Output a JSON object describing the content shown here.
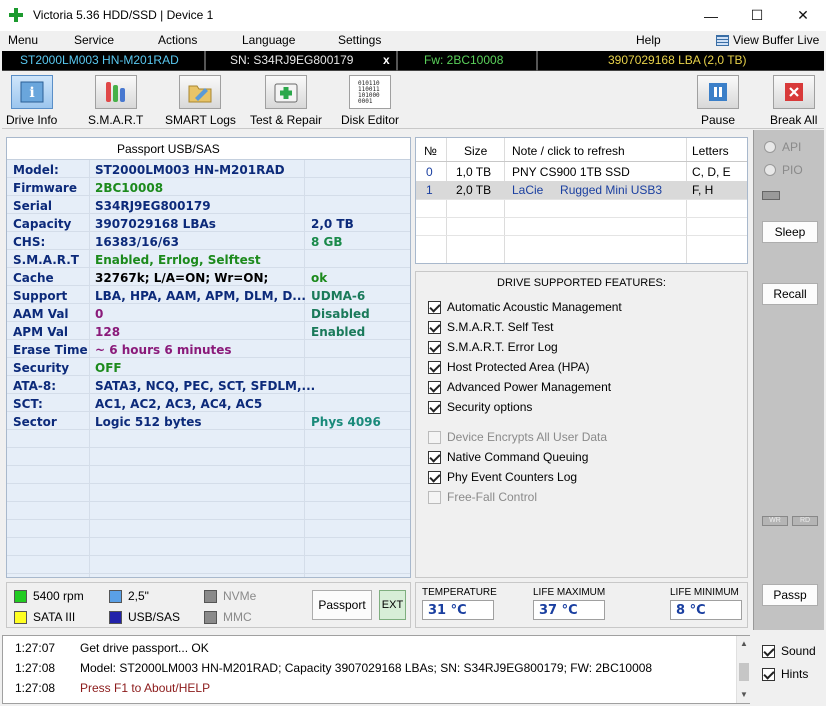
{
  "window": {
    "title": "Victoria 5.36 HDD/SSD | Device 1",
    "minimize": "—",
    "maximize": "☐",
    "close": "✕"
  },
  "menu": {
    "items": [
      "Menu",
      "Service",
      "Actions",
      "Language",
      "Settings",
      "Help"
    ],
    "view_buffer": "View Buffer Live"
  },
  "device_bar": {
    "model": "ST2000LM003 HN-M201RAD",
    "serial": "SN: S34RJ9EG800179",
    "close": "x",
    "firmware": "Fw: 2BC10008",
    "lba": "3907029168 LBA (2,0 TB)"
  },
  "toolbar": {
    "drive_info": "Drive Info",
    "smart": "S.M.A.R.T",
    "smart_logs": "SMART Logs",
    "test_repair": "Test & Repair",
    "disk_editor": "Disk Editor",
    "pause": "Pause",
    "break_all": "Break All",
    "disk_editor_bits": "010110\n110011\n101000\n0001"
  },
  "passport": {
    "title": "Passport USB/SAS",
    "rows": [
      {
        "k": "Model:",
        "v": "ST2000LM003 HN-M201RAD",
        "x": ""
      },
      {
        "k": "Firmware",
        "v": "2BC10008",
        "x": ""
      },
      {
        "k": "Serial",
        "v": "S34RJ9EG800179",
        "x": ""
      },
      {
        "k": "Capacity",
        "v": "3907029168 LBAs",
        "x": "2,0 TB"
      },
      {
        "k": "CHS:",
        "v": "16383/16/63",
        "x": "8 GB"
      },
      {
        "k": "S.M.A.R.T",
        "v": "Enabled, Errlog, Selftest",
        "x": ""
      },
      {
        "k": "Cache",
        "v": "32767k; L/A=ON; Wr=ON;",
        "x": "ok"
      },
      {
        "k": "Support",
        "v": "LBA, HPA, AAM, APM, DLM, D...",
        "x": "UDMA-6"
      },
      {
        "k": "AAM Val",
        "v": "0",
        "x": "Disabled"
      },
      {
        "k": "APM Val",
        "v": "128",
        "x": "Enabled"
      },
      {
        "k": "Erase Time",
        "v": "~ 6 hours 6 minutes",
        "x": ""
      },
      {
        "k": "Security",
        "v": "OFF",
        "x": ""
      },
      {
        "k": "ATA-8:",
        "v": "SATA3, NCQ, PEC, SCT, SFDLM,...",
        "x": ""
      },
      {
        "k": "SCT:",
        "v": "AC1, AC2, AC3, AC4, AC5",
        "x": ""
      },
      {
        "k": "Sector",
        "v": "Logic 512 bytes",
        "x": "Phys 4096"
      }
    ]
  },
  "disks": {
    "headers": [
      "№",
      "Size",
      "Note / click to refresh",
      "Letters"
    ],
    "rows": [
      {
        "n": "0",
        "size": "1,0 TB",
        "note": "PNY CS900 1TB SSD",
        "letters": "C, D, E"
      },
      {
        "n": "1",
        "size": "2,0 TB",
        "note": "LaCie     Rugged Mini USB3",
        "letters": "F, H"
      }
    ]
  },
  "features": {
    "title": "DRIVE SUPPORTED FEATURES:",
    "items": [
      {
        "label": "Automatic Acoustic Management",
        "checked": true,
        "enabled": true
      },
      {
        "label": "S.M.A.R.T. Self Test",
        "checked": true,
        "enabled": true
      },
      {
        "label": "S.M.A.R.T. Error Log",
        "checked": true,
        "enabled": true
      },
      {
        "label": "Host Protected Area (HPA)",
        "checked": true,
        "enabled": true
      },
      {
        "label": "Advanced Power Management",
        "checked": true,
        "enabled": true
      },
      {
        "label": "Security options",
        "checked": true,
        "enabled": true
      },
      {
        "label": "Device Encrypts All User Data",
        "checked": false,
        "enabled": false
      },
      {
        "label": "Native Command Queuing",
        "checked": true,
        "enabled": true
      },
      {
        "label": "Phy Event Counters Log",
        "checked": true,
        "enabled": true
      },
      {
        "label": "Free-Fall Control",
        "checked": false,
        "enabled": false
      }
    ]
  },
  "side": {
    "api": "API",
    "pio": "PIO",
    "sleep": "Sleep",
    "recall": "Recall",
    "passp": "Passp",
    "wr": "WR",
    "rd": "RD"
  },
  "legend": {
    "rpm": "5400 rpm",
    "size": "2,5\"",
    "nvme": "NVMe",
    "sata": "SATA III",
    "usbsas": "USB/SAS",
    "mmc": "MMC",
    "passport_btn": "Passport",
    "ext_btn": "EXT",
    "colors": {
      "rpm": "#22cc22",
      "size": "#5aa0e6",
      "nvme": "#8a8a8a",
      "sata": "#ffff22",
      "usbsas": "#2222aa",
      "mmc": "#8a8a8a"
    }
  },
  "stats": {
    "temperature_label": "TEMPERATURE",
    "temperature": "31 °C",
    "life_max_label": "LIFE MAXIMUM",
    "life_max": "37 °C",
    "life_min_label": "LIFE MINIMUM",
    "life_min": "8 °C"
  },
  "log": [
    {
      "time": "1:27:07",
      "msg": "Get drive passport... OK",
      "color": "#000000"
    },
    {
      "time": "1:27:08",
      "msg": "Model: ST2000LM003 HN-M201RAD; Capacity 3907029168 LBAs; SN: S34RJ9EG800179; FW: 2BC10008",
      "color": "#000000"
    },
    {
      "time": "1:27:08",
      "msg": "Press F1 to About/HELP",
      "color": "#8b1a1a"
    }
  ],
  "checks": {
    "sound": "Sound",
    "hints": "Hints"
  }
}
